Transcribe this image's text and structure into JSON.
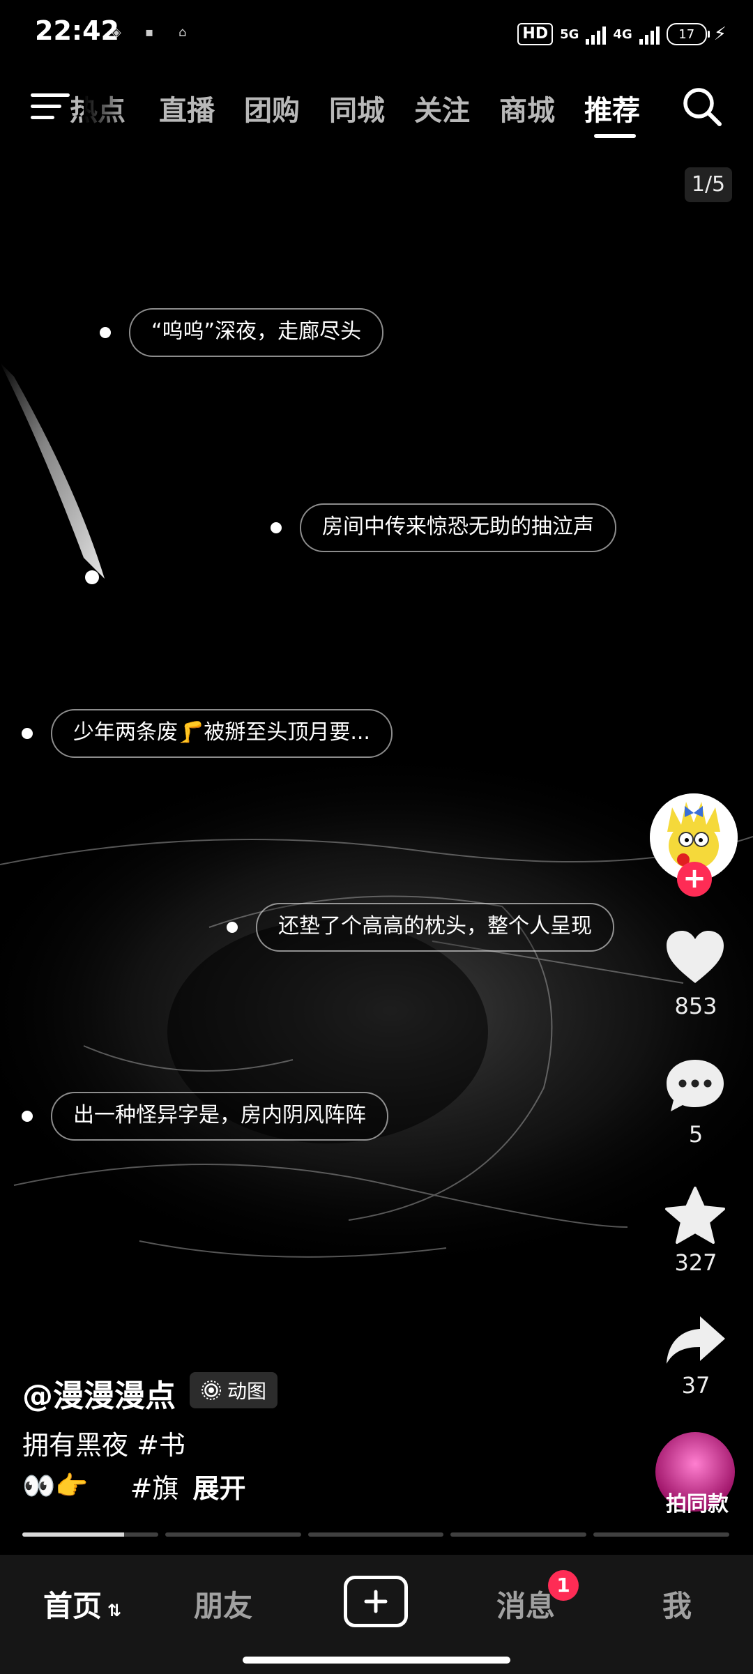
{
  "status_bar": {
    "time": "22:42",
    "hd_label": "HD",
    "net1": "5G",
    "net2": "4G",
    "battery": "17"
  },
  "top_nav": {
    "tabs": [
      "热点",
      "直播",
      "团购",
      "同城",
      "关注",
      "商城",
      "推荐"
    ],
    "active_tab": "推荐"
  },
  "page_indicator": "1/5",
  "lyrics": [
    "“呜呜”深夜，走廊尽头",
    "房间中传来惊恐无助的抽泣声",
    "少年两条废🦵被掰至头顶月要...",
    "还垫了个高高的枕头，整个人呈现",
    "出一种怪异字是，房内阴风阵阵"
  ],
  "rail": {
    "likes": "853",
    "comments": "5",
    "favorites": "327",
    "shares": "37",
    "remix_label": "拍同款"
  },
  "caption": {
    "author": "@漫漫漫点",
    "type_badge": "动图",
    "line1": "拥有黑夜 #书",
    "line2_emoji": "👀👉",
    "line2_tag": "#旗",
    "expand": "展开"
  },
  "progress": {
    "segments": 5,
    "current_fill": 0.75
  },
  "bottom_bar": {
    "home": "首页",
    "friends": "朋友",
    "messages": "消息",
    "messages_badge": "1",
    "me": "我"
  },
  "colors": {
    "accent": "#fe2c55",
    "bar_bg": "#161616"
  }
}
